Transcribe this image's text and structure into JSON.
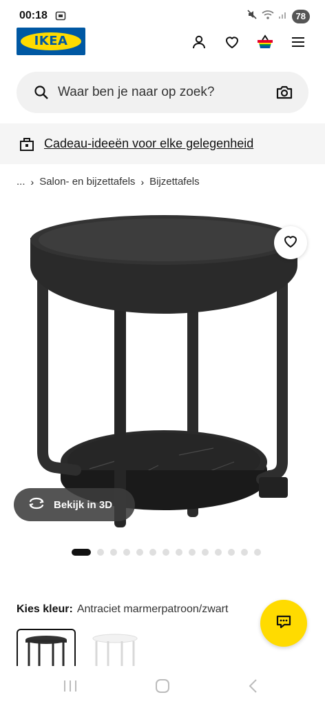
{
  "status_bar": {
    "time": "00:18",
    "battery": "78"
  },
  "header": {
    "logo_text": "IKEA",
    "icons": [
      "account-icon",
      "heart-icon",
      "basket-icon",
      "menu-icon"
    ]
  },
  "search": {
    "placeholder": "Waar ben je naar op zoek?"
  },
  "promo": {
    "text": "Cadeau-ideeën voor elke gelegenheid"
  },
  "breadcrumb": {
    "ellipsis": "...",
    "level1": "Salon- en bijzettafels",
    "level2": "Bijzettafels"
  },
  "gallery": {
    "view_3d_label": "Bekijk in 3D",
    "image_count": 14,
    "active_index": 0
  },
  "color_chooser": {
    "label": "Kies kleur:",
    "value": "Antraciet marmerpatroon/zwart"
  },
  "colors": {
    "brand_blue": "#0058a3",
    "brand_yellow": "#ffdb00"
  }
}
